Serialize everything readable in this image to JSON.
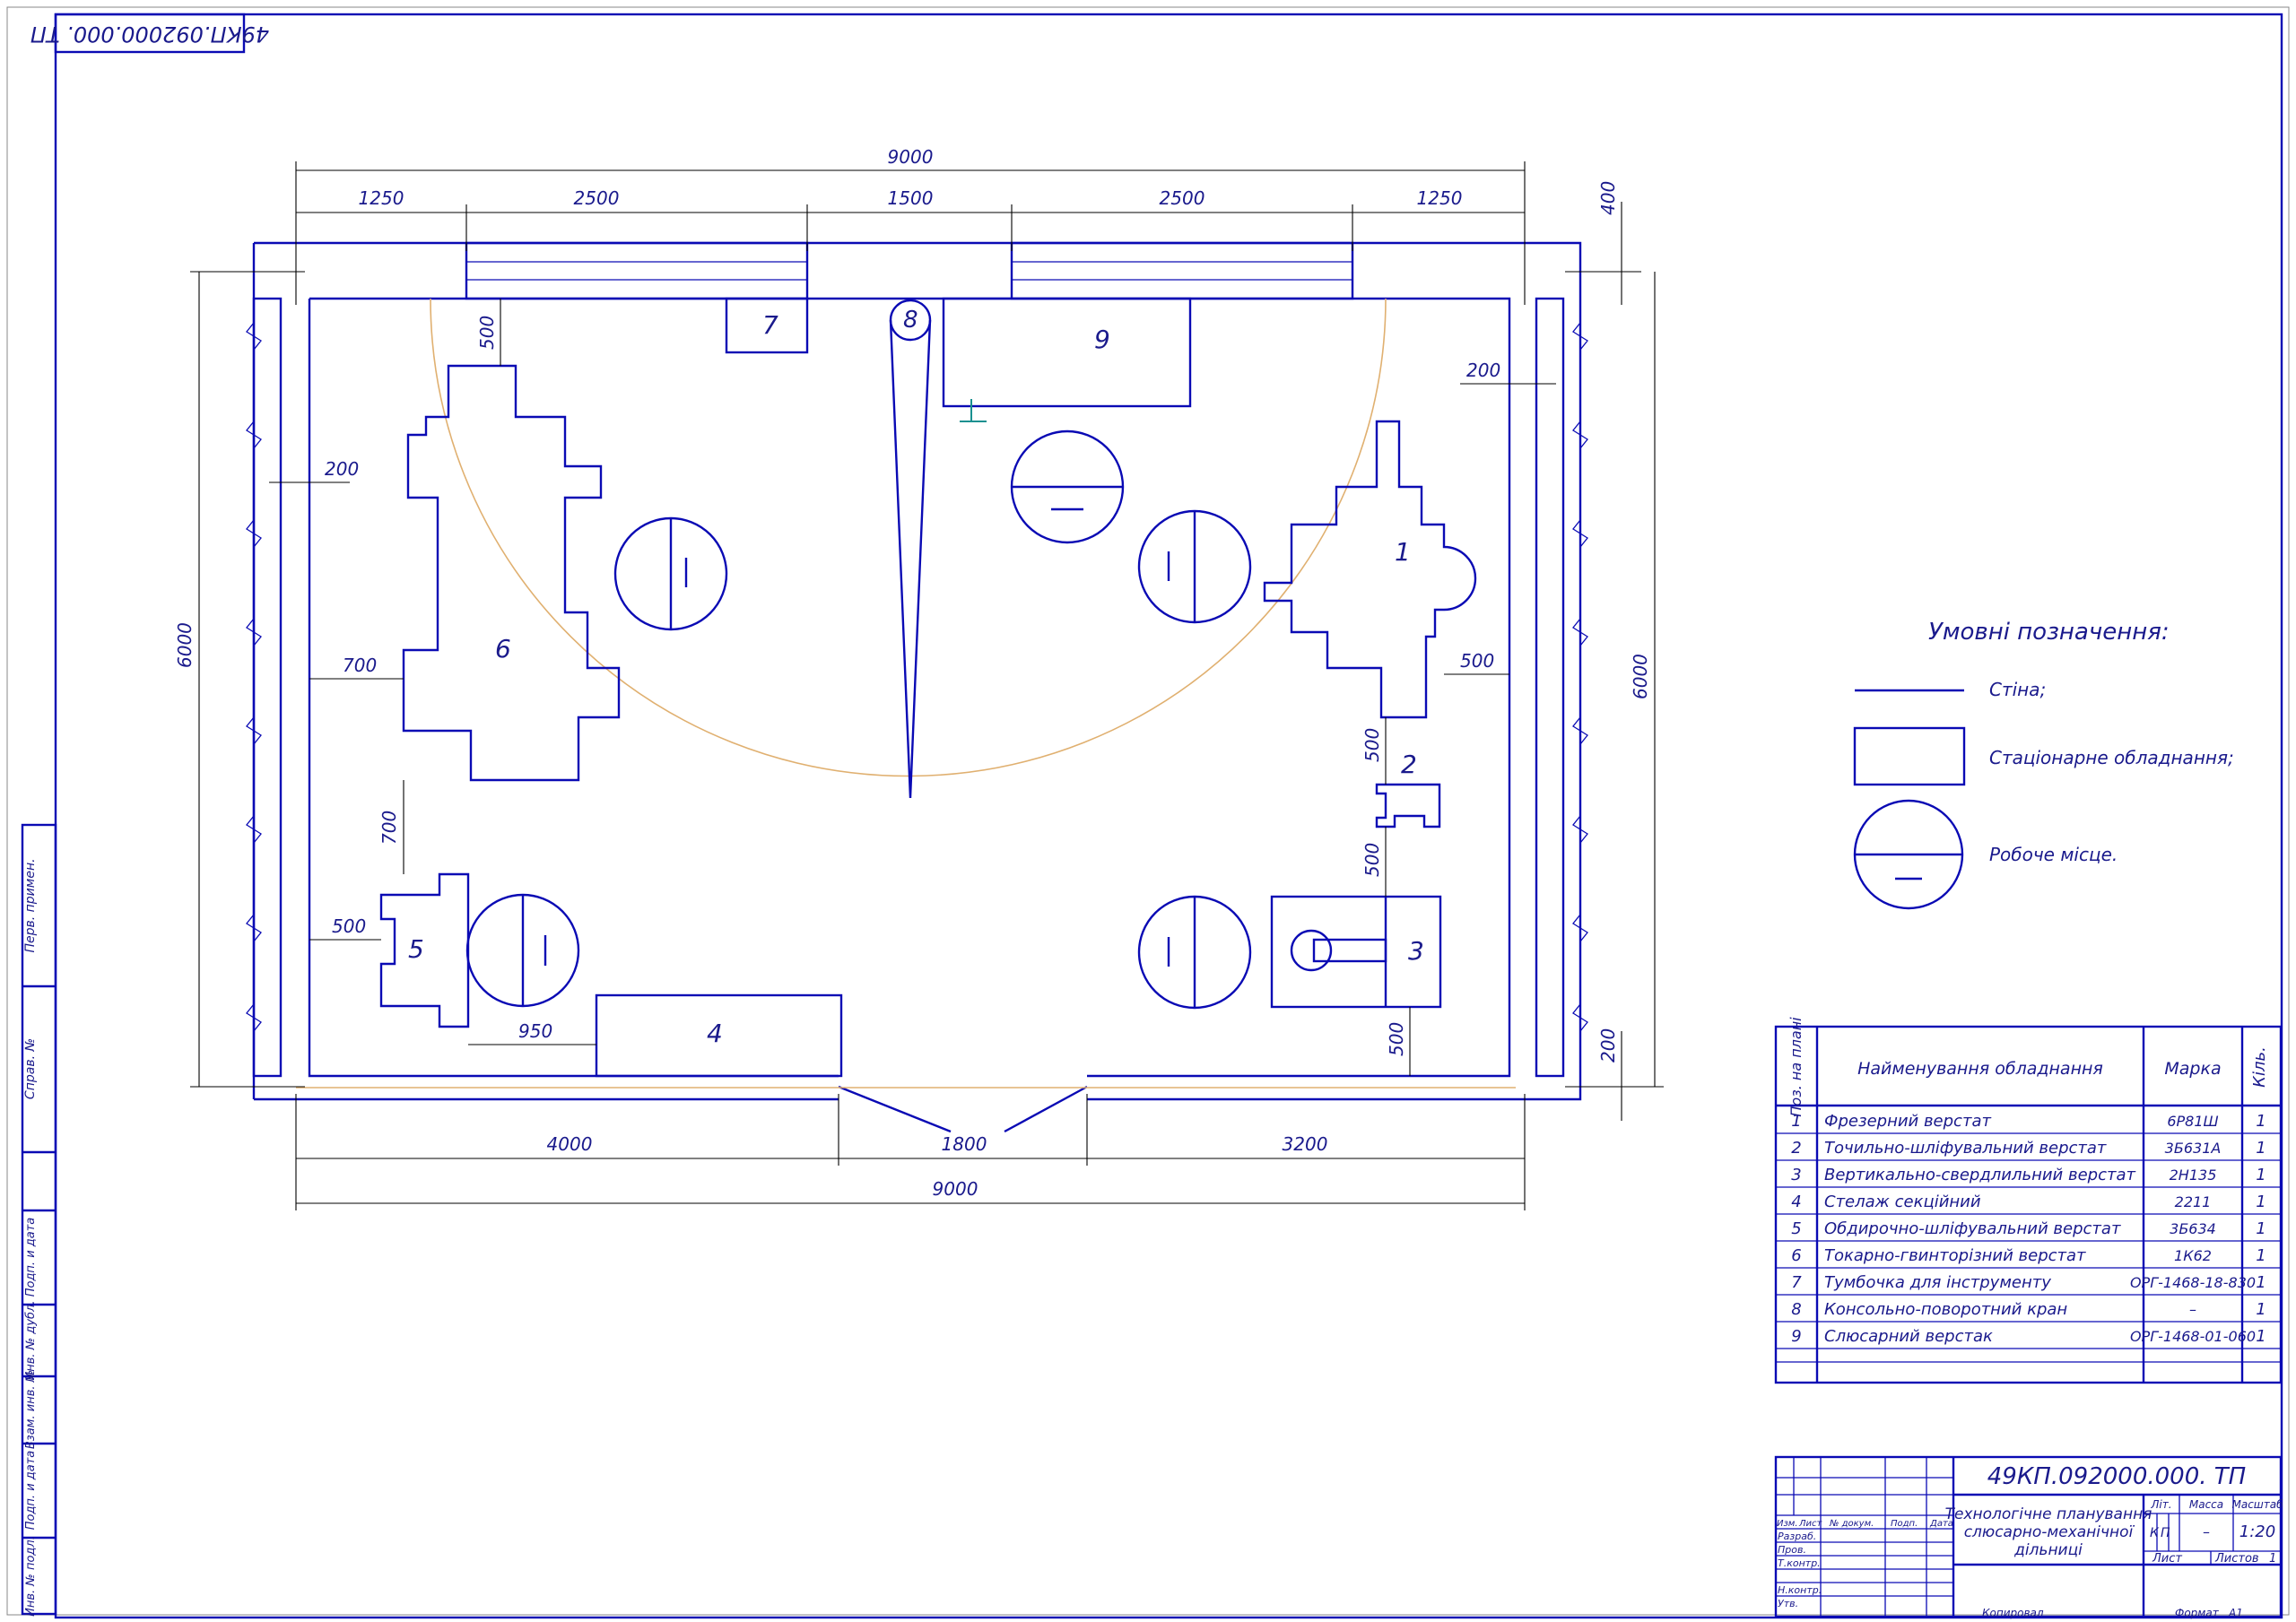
{
  "stamp_rotated": "49КП.092000.000. ТП",
  "dims": {
    "total_top": "9000",
    "seg1": "1250",
    "seg2": "2500",
    "seg3": "1500",
    "seg4": "2500",
    "seg5": "1250",
    "right_top": "400",
    "left_height": "6000",
    "right_height": "6000",
    "left_200": "200",
    "right_200": "200",
    "d500_top": "500",
    "d700_left": "700",
    "d700_mid": "700",
    "d500_left": "500",
    "d950": "950",
    "d500_right": "500",
    "d500_2a": "500",
    "d500_2b": "500",
    "d500_3": "500",
    "d200_br": "200",
    "bottom_4000": "4000",
    "bottom_1800": "1800",
    "bottom_3200": "3200",
    "total_bottom": "9000"
  },
  "equipment_labels": [
    "1",
    "2",
    "3",
    "4",
    "5",
    "6",
    "7",
    "8",
    "9"
  ],
  "legend": {
    "title": "Умовні позначення:",
    "wall": "Стіна;",
    "stationary": "Стаціонарне обладнання;",
    "workplace": "Робоче місце."
  },
  "table": {
    "headers": {
      "pos": "Поз. на плані",
      "name": "Найменування обладнання",
      "mark": "Марка",
      "qty": "Кіль."
    },
    "rows": [
      {
        "pos": "1",
        "name": "Фрезерний верстат",
        "mark": "6Р81Ш",
        "qty": "1"
      },
      {
        "pos": "2",
        "name": "Точильно-шліфувальний верстат",
        "mark": "3Б631А",
        "qty": "1"
      },
      {
        "pos": "3",
        "name": "Вертикально-свердлильний верстат",
        "mark": "2Н135",
        "qty": "1"
      },
      {
        "pos": "4",
        "name": "Стелаж секційний",
        "mark": "2211",
        "qty": "1"
      },
      {
        "pos": "5",
        "name": "Обдирочно-шліфувальний верстат",
        "mark": "3Б634",
        "qty": "1"
      },
      {
        "pos": "6",
        "name": "Токарно-гвинторізний верстат",
        "mark": "1К62",
        "qty": "1"
      },
      {
        "pos": "7",
        "name": "Тумбочка для інструменту",
        "mark": "ОРГ-1468-18-830",
        "qty": "1"
      },
      {
        "pos": "8",
        "name": "Консольно-поворотний кран",
        "mark": "–",
        "qty": "1"
      },
      {
        "pos": "9",
        "name": "Слюсарний верстак",
        "mark": "ОРГ-1468-01-060",
        "qty": "1"
      }
    ]
  },
  "title_block": {
    "code": "49КП.092000.000. ТП",
    "title_l1": "Технологічне планування",
    "title_l2": "слюсарно-механічної",
    "title_l3": "дільниці",
    "lit": "Літ.",
    "mass": "Масса",
    "scale": "Масштаб",
    "lit_k": "К",
    "lit_p": "П",
    "mass_val": "–",
    "scale_val": "1:20",
    "sheet": "Лист",
    "sheets": "Листов",
    "sheets_val": "1",
    "izm": "Изм.",
    "list": "Лист",
    "doc": "№ докум.",
    "sign": "Подп.",
    "date": "Дата",
    "razrab": "Разраб.",
    "prov": "Пров.",
    "tkontr": "Т.контр.",
    "nkontr": "Н.контр.",
    "utv": "Утв.",
    "kopir": "Копировал",
    "format": "Формат",
    "format_val": "A1"
  },
  "side_stamp": {
    "perv": "Перв. примен.",
    "sprav": "Справ. №",
    "podp1": "Подп. и дата",
    "inv_dubl": "Инв. № дубл.",
    "vzam": "Взам. инв. №",
    "podp2": "Подп. и дата",
    "inv_podl": "Инв. № подл."
  }
}
